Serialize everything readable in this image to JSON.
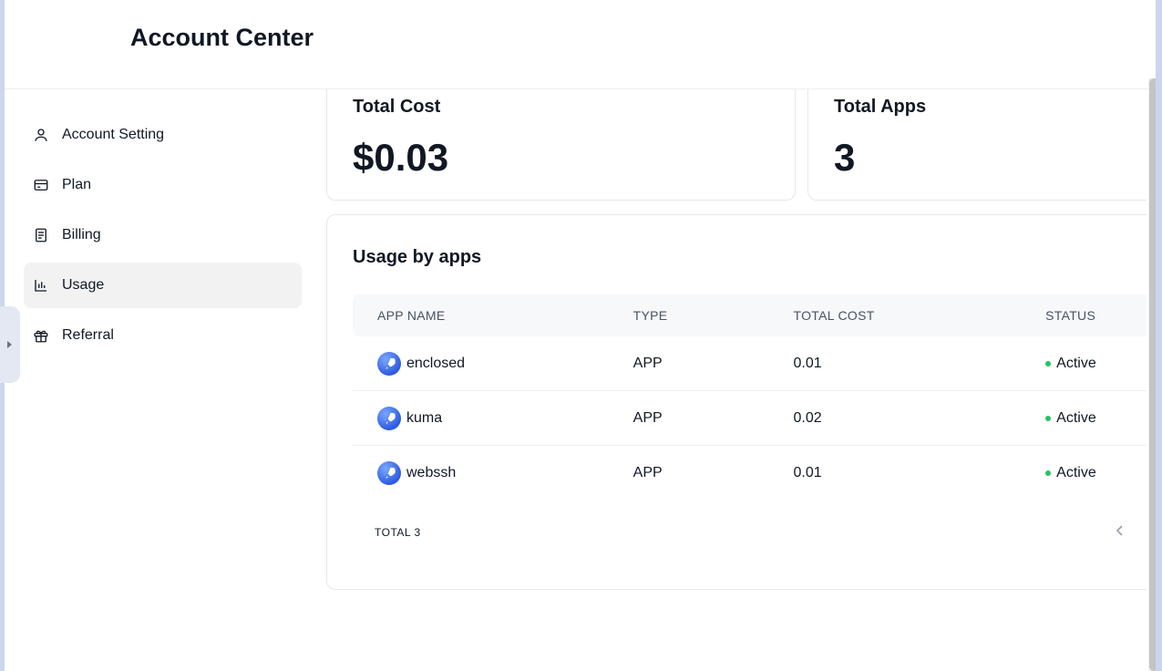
{
  "header": {
    "title": "Account Center"
  },
  "sidebar": {
    "items": [
      {
        "label": "Account Setting",
        "icon": "user-icon",
        "active": false
      },
      {
        "label": "Plan",
        "icon": "card-icon",
        "active": false
      },
      {
        "label": "Billing",
        "icon": "receipt-icon",
        "active": false
      },
      {
        "label": "Usage",
        "icon": "bar-chart-icon",
        "active": true
      },
      {
        "label": "Referral",
        "icon": "gift-icon",
        "active": false
      }
    ]
  },
  "summary": {
    "total_cost_label": "Total Cost",
    "total_cost_value": "$0.03",
    "total_apps_label": "Total Apps",
    "total_apps_value": "3"
  },
  "usage": {
    "title": "Usage by apps",
    "columns": [
      "APP NAME",
      "TYPE",
      "TOTAL COST",
      "STATUS"
    ],
    "rows": [
      {
        "name": "enclosed",
        "type": "APP",
        "cost": "0.01",
        "status": "Active"
      },
      {
        "name": "kuma",
        "type": "APP",
        "cost": "0.02",
        "status": "Active"
      },
      {
        "name": "webssh",
        "type": "APP",
        "cost": "0.01",
        "status": "Active"
      }
    ],
    "total": "TOTAL 3"
  },
  "colors": {
    "status_active": "#22c55e",
    "active_nav_bg": "#f2f2f3"
  }
}
